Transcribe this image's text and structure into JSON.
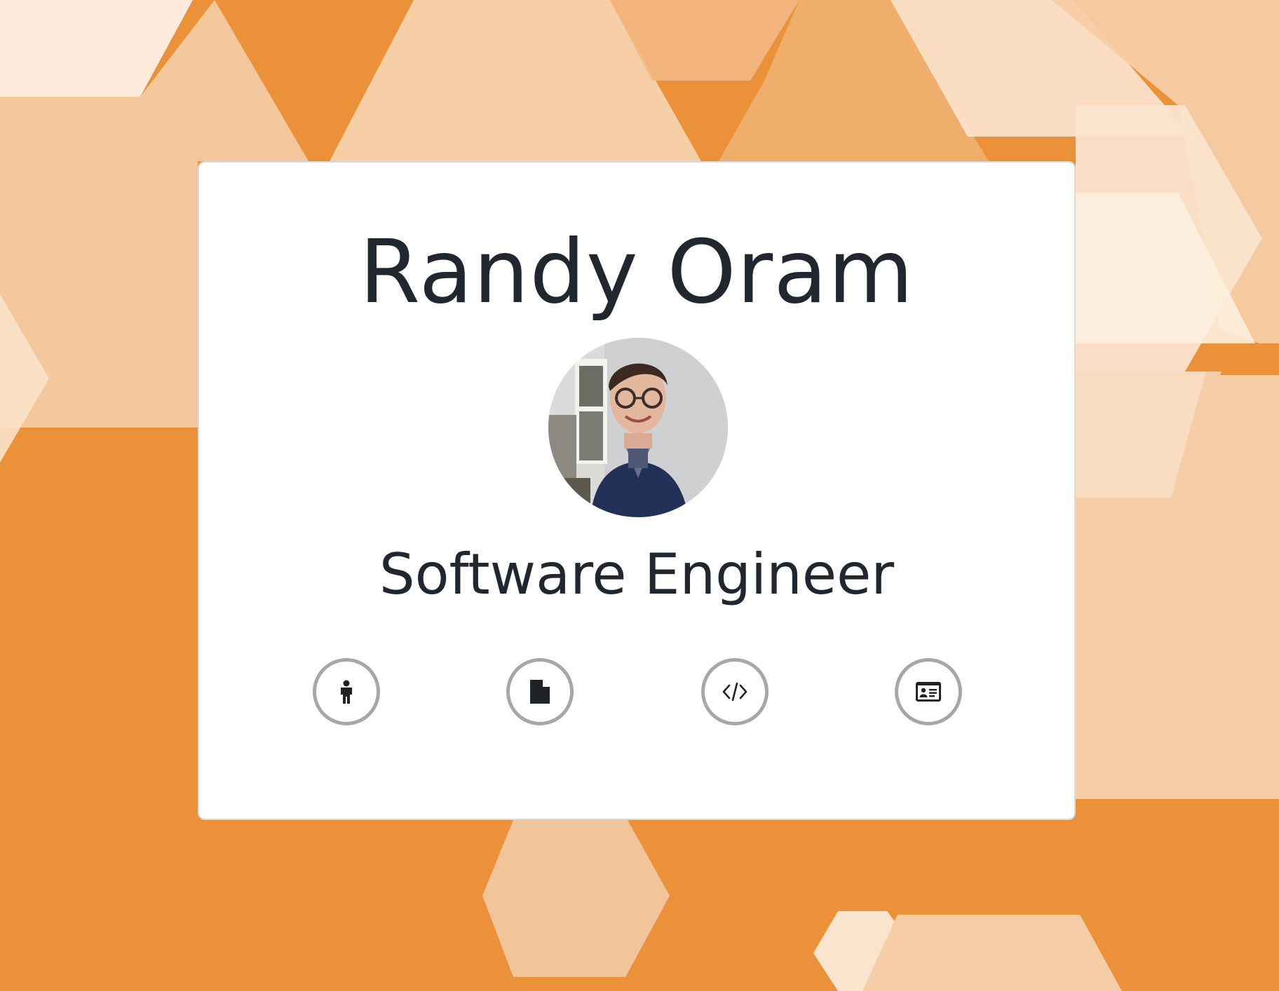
{
  "profile": {
    "name": "Randy Oram",
    "title": "Software Engineer",
    "avatar": "profile-photo"
  },
  "nav_buttons": [
    {
      "icon": "person-icon"
    },
    {
      "icon": "document-icon"
    },
    {
      "icon": "code-icon"
    },
    {
      "icon": "id-card-icon"
    }
  ],
  "colors": {
    "background": "#ea913a",
    "card": "#ffffff",
    "text": "#22262e",
    "button_border": "#a5a7ac",
    "icon": "#1f2227"
  }
}
